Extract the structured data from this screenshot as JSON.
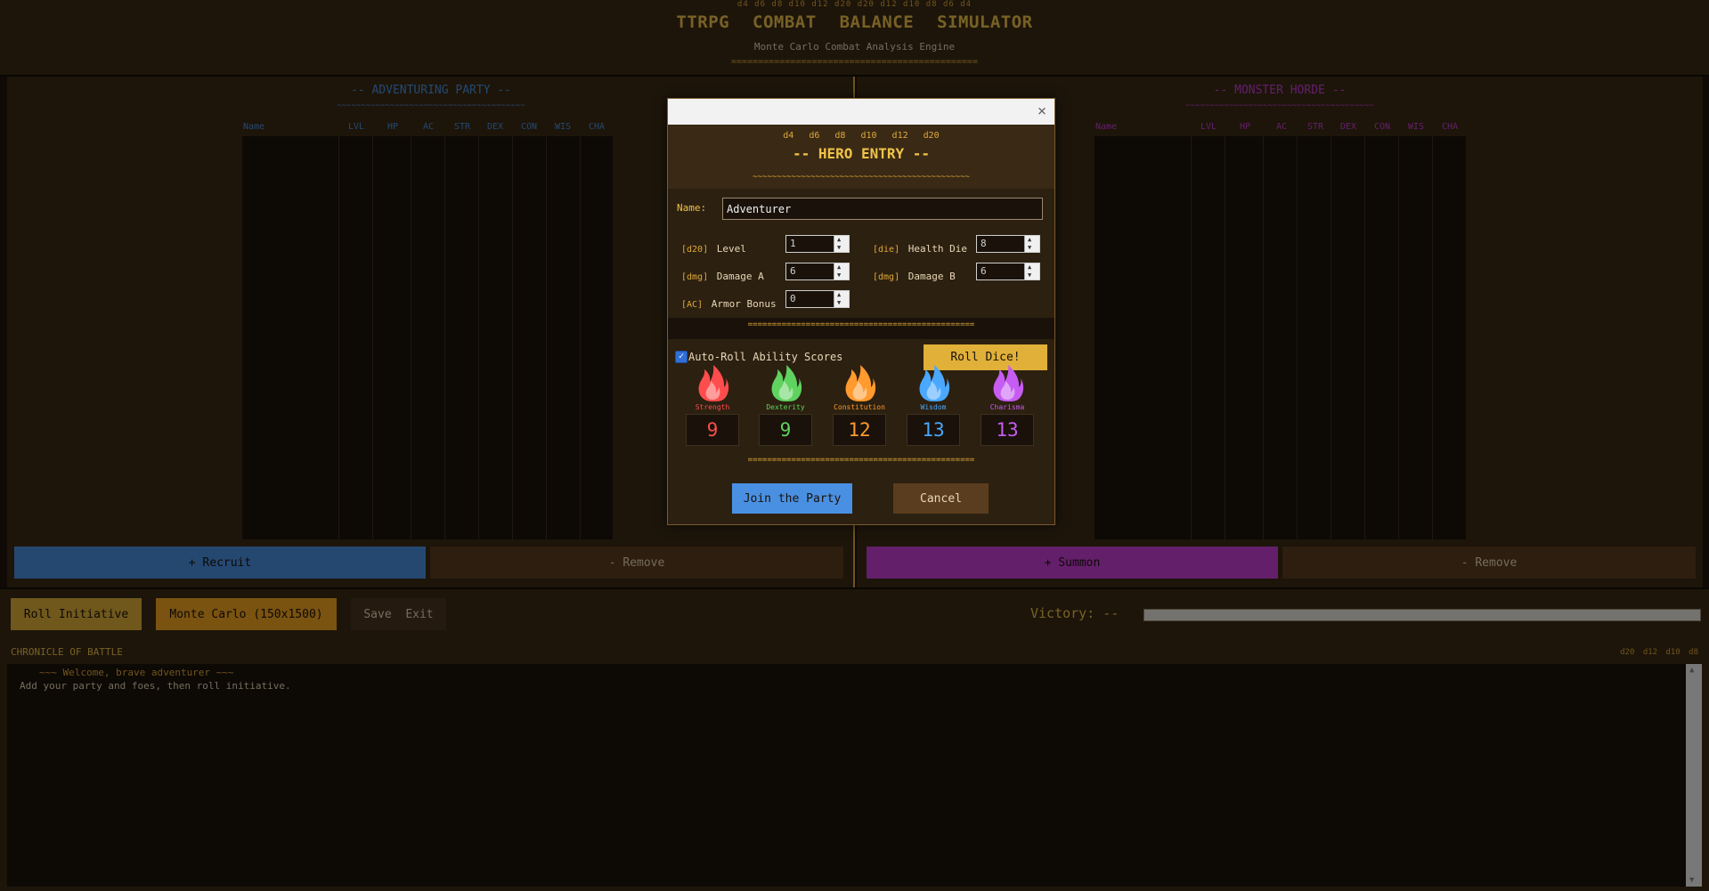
{
  "colors": {
    "gold": "#f0c24a",
    "party_blue": "#4a90e2",
    "horde_magenta": "#c83fd6",
    "panel_brown": "#3a2a15",
    "dark": "#1a120a",
    "strength": "#ff4d4d",
    "dexterity": "#5fd25f",
    "constitution": "#ff9a2e",
    "wisdom": "#4aa8ff",
    "charisma": "#c65cf2"
  },
  "header": {
    "dice": "d4  d6  d8  d10  d12  d20  d20  d12  d10  d8  d6  d4",
    "title": "TTRPG COMBAT BALANCE SIMULATOR",
    "subtitle": "Monte Carlo Combat Analysis Engine",
    "rule": "=============================================="
  },
  "party": {
    "title": "-- ADVENTURING PARTY --",
    "rule": "~~~~~~~~~~~~~~~~~~~~~~~~~~~~~~~~~~~~~~~",
    "columns": [
      "Name",
      "LVL",
      "HP",
      "AC",
      "STR",
      "DEX",
      "CON",
      "WIS",
      "CHA"
    ],
    "add_label": "+ Recruit",
    "remove_label": "- Remove"
  },
  "horde": {
    "title": "-- MONSTER HORDE --",
    "rule": "~~~~~~~~~~~~~~~~~~~~~~~~~~~~~~~~~~~~~~~",
    "columns": [
      "Name",
      "LVL",
      "HP",
      "AC",
      "STR",
      "DEX",
      "CON",
      "WIS",
      "CHA"
    ],
    "add_label": "+ Summon",
    "remove_label": "- Remove"
  },
  "toolbar": {
    "roll_initiative": "Roll Initiative",
    "monte_carlo": "Monte Carlo (150x1500)",
    "save_exit": "Save  Exit",
    "victory_label": "Victory: --",
    "victory_fraction": 0
  },
  "chronicle": {
    "title": "CHRONICLE OF BATTLE",
    "dice": "d20 d12 d10 d8",
    "lines": [
      "~~~ Welcome, brave adventurer ~~~",
      "Add your party and foes, then roll initiative."
    ]
  },
  "dialog": {
    "close_icon": "×",
    "dice": "d4 d6 d8 d10 d12 d20",
    "title": "-- HERO ENTRY --",
    "rule_top": "~~~~~~~~~~~~~~~~~~~~~~~~~~~~~~~~~~~~~~~~~~~~~",
    "rule_mid": "===============================================",
    "rule_bottom": "===============================================",
    "name_label": "Name:",
    "name_value": "Adventurer",
    "fields": {
      "level": {
        "tag": "[d20]",
        "label": "Level",
        "value": "1"
      },
      "health_die": {
        "tag": "[die]",
        "label": "Health Die",
        "value": "8"
      },
      "damage_a": {
        "tag": "[dmg]",
        "label": "Damage A",
        "value": "6"
      },
      "damage_b": {
        "tag": "[dmg]",
        "label": "Damage B",
        "value": "6"
      },
      "armor_bonus": {
        "tag": "[AC]",
        "label": "Armor Bonus",
        "value": "0"
      }
    },
    "autoroll_label": "Auto-Roll Ability Scores",
    "autoroll_checked": true,
    "roll_label": "Roll Dice!",
    "abilities": [
      {
        "name": "Strength",
        "score": "9",
        "color": "#ff4d4d",
        "icon": "red-flame-icon"
      },
      {
        "name": "Dexterity",
        "score": "9",
        "color": "#5fd25f",
        "icon": "green-flame-icon"
      },
      {
        "name": "Constitution",
        "score": "12",
        "color": "#ff9a2e",
        "icon": "orange-flame-icon"
      },
      {
        "name": "Wisdom",
        "score": "13",
        "color": "#4aa8ff",
        "icon": "blue-flame-icon"
      },
      {
        "name": "Charisma",
        "score": "13",
        "color": "#c65cf2",
        "icon": "purple-flame-icon"
      }
    ],
    "join_label": "Join the Party",
    "cancel_label": "Cancel"
  }
}
